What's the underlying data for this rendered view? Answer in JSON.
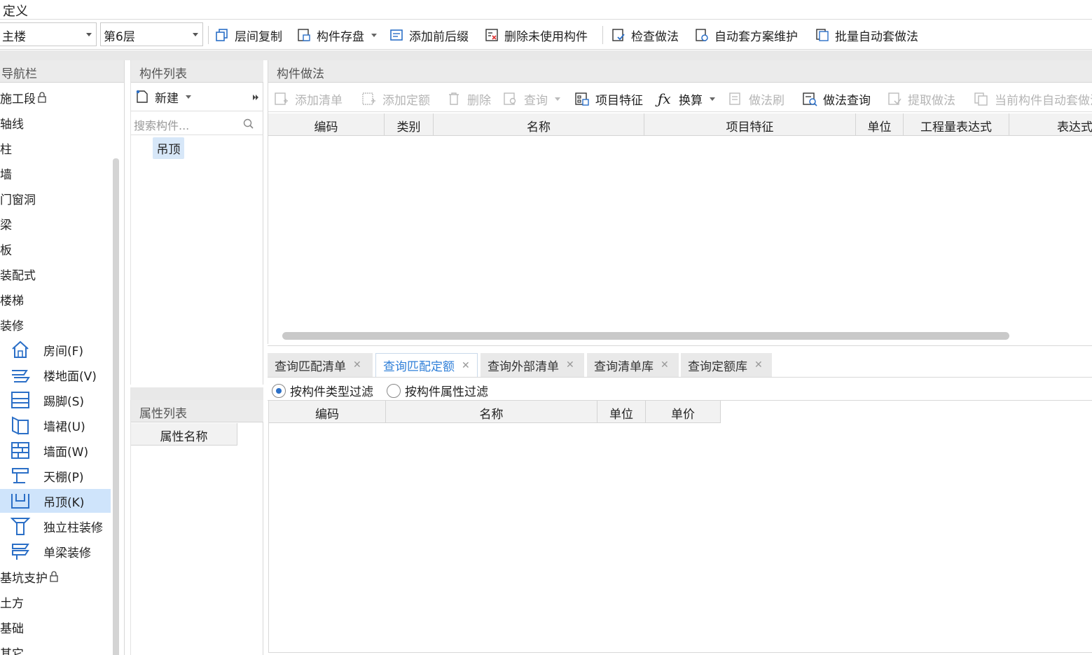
{
  "window": {
    "title": "定义"
  },
  "toolbar": {
    "floor_group": "主楼",
    "floor": "第6层",
    "buttons": [
      {
        "label": "层间复制",
        "icon": "copy-icon",
        "dropdown": false
      },
      {
        "label": "构件存盘",
        "icon": "save-icon",
        "dropdown": true
      },
      {
        "label": "添加前后缀",
        "icon": "prefix-icon",
        "dropdown": false
      },
      {
        "label": "删除未使用构件",
        "icon": "delete-unused-icon",
        "dropdown": false
      },
      {
        "label": "检查做法",
        "icon": "check-icon",
        "dropdown": false
      },
      {
        "label": "自动套方案维护",
        "icon": "scheme-icon",
        "dropdown": false
      },
      {
        "label": "批量自动套做法",
        "icon": "batch-icon",
        "dropdown": false
      }
    ]
  },
  "nav": {
    "title": "导航栏",
    "items": [
      {
        "label": "施工段",
        "lock": true
      },
      {
        "label": "轴线"
      },
      {
        "label": "柱"
      },
      {
        "label": "墙"
      },
      {
        "label": "门窗洞"
      },
      {
        "label": "梁"
      },
      {
        "label": "板"
      },
      {
        "label": "装配式"
      },
      {
        "label": "楼梯"
      },
      {
        "label": "装修"
      }
    ],
    "sub_items": [
      {
        "label": "房间(F)",
        "icon": "room-icon"
      },
      {
        "label": "楼地面(V)",
        "icon": "floor-icon"
      },
      {
        "label": "踢脚(S)",
        "icon": "skirting-icon"
      },
      {
        "label": "墙裙(U)",
        "icon": "dado-icon"
      },
      {
        "label": "墙面(W)",
        "icon": "wall-face-icon"
      },
      {
        "label": "天棚(P)",
        "icon": "ceiling-icon"
      },
      {
        "label": "吊顶(K)",
        "icon": "suspended-ceiling-icon",
        "selected": true
      },
      {
        "label": "独立柱装修",
        "icon": "column-finish-icon"
      },
      {
        "label": "单梁装修",
        "icon": "beam-finish-icon"
      }
    ],
    "more_items": [
      {
        "label": "基坑支护",
        "lock": true
      },
      {
        "label": "土方"
      },
      {
        "label": "基础"
      },
      {
        "label": "其它"
      }
    ]
  },
  "component_list": {
    "title": "构件列表",
    "new_label": "新建",
    "search_placeholder": "搜索构件...",
    "items": [
      "吊顶"
    ]
  },
  "property_list": {
    "title": "属性列表",
    "column": "属性名称"
  },
  "method": {
    "title": "构件做法",
    "tools": [
      {
        "label": "添加清单",
        "enabled": false,
        "dropdown": false,
        "icon": "add-list-icon"
      },
      {
        "label": "添加定额",
        "enabled": false,
        "dropdown": false,
        "icon": "add-quota-icon"
      },
      {
        "label": "删除",
        "enabled": false,
        "dropdown": false,
        "icon": "trash-icon"
      },
      {
        "label": "查询",
        "enabled": false,
        "dropdown": true,
        "icon": "query-icon"
      },
      {
        "label": "项目特征",
        "enabled": true,
        "dropdown": false,
        "icon": "feature-icon"
      },
      {
        "label": "换算",
        "enabled": true,
        "dropdown": true,
        "icon": "fx-icon"
      },
      {
        "label": "做法刷",
        "enabled": false,
        "dropdown": false,
        "icon": "brush-icon"
      },
      {
        "label": "做法查询",
        "enabled": true,
        "dropdown": false,
        "icon": "method-query-icon"
      },
      {
        "label": "提取做法",
        "enabled": false,
        "dropdown": false,
        "icon": "extract-icon"
      },
      {
        "label": "当前构件自动套做法",
        "enabled": false,
        "dropdown": false,
        "icon": "auto-icon"
      }
    ],
    "columns": [
      "编码",
      "类别",
      "名称",
      "项目特征",
      "单位",
      "工程量表达式",
      "表达式说明"
    ]
  },
  "query": {
    "tabs": [
      {
        "label": "查询匹配清单",
        "active": false
      },
      {
        "label": "查询匹配定额",
        "active": true
      },
      {
        "label": "查询外部清单",
        "active": false
      },
      {
        "label": "查询清单库",
        "active": false
      },
      {
        "label": "查询定额库",
        "active": false
      }
    ],
    "filters": [
      {
        "label": "按构件类型过滤",
        "checked": true
      },
      {
        "label": "按构件属性过滤",
        "checked": false
      }
    ],
    "columns": [
      "编码",
      "名称",
      "单位",
      "单价"
    ]
  },
  "colors": {
    "accent": "#2f7fd8",
    "selection": "#cfe4fb",
    "panel_header": "#ebebeb"
  }
}
